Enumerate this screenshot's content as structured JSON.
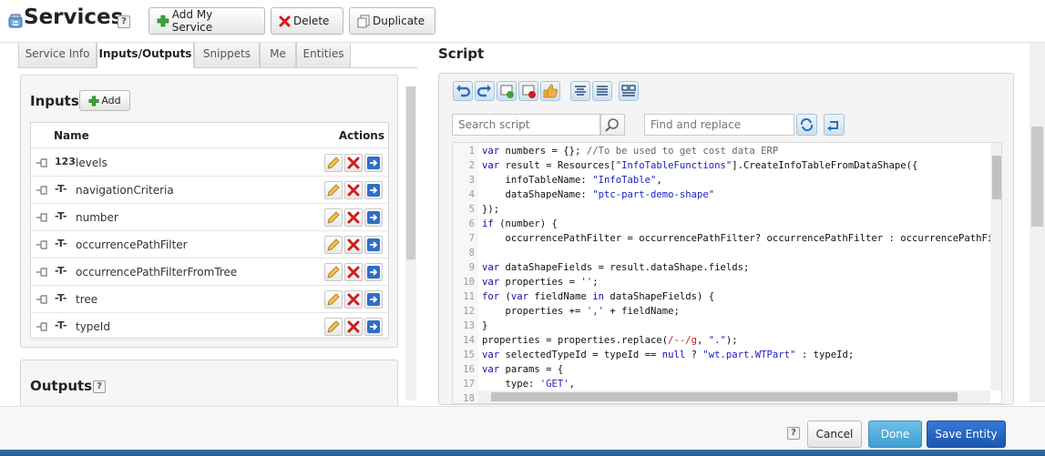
{
  "header": {
    "title": "Services",
    "help_label": "?",
    "add_service_label": "Add My Service",
    "delete_label": "Delete",
    "duplicate_label": "Duplicate"
  },
  "tabs": [
    "Service Info",
    "Inputs/Outputs",
    "Snippets",
    "Me",
    "Entities"
  ],
  "active_tab": "Inputs/Outputs",
  "inputs": {
    "heading": "Inputs",
    "add_label": "Add",
    "col_name": "Name",
    "col_actions": "Actions",
    "rows": [
      {
        "type_icon": "123",
        "name": "levels"
      },
      {
        "type_icon": "-T-",
        "name": "navigationCriteria"
      },
      {
        "type_icon": "-T-",
        "name": "number"
      },
      {
        "type_icon": "-T-",
        "name": "occurrencePathFilter"
      },
      {
        "type_icon": "-T-",
        "name": "occurrencePathFilterFromTree"
      },
      {
        "type_icon": "-T-",
        "name": "tree"
      },
      {
        "type_icon": "-T-",
        "name": "typeId"
      }
    ]
  },
  "outputs": {
    "heading": "Outputs",
    "help_label": "?"
  },
  "script": {
    "heading": "Script",
    "search_placeholder": "Search script",
    "find_placeholder": "Find and replace",
    "lines": [
      {
        "n": "1",
        "html": "<span class=\"kw\">var</span> numbers = {}; <span class=\"cm\">//To be used to get cost data ERP</span>"
      },
      {
        "n": "2",
        "html": "<span class=\"kw\">var</span> result = Resources[<span class=\"str\">\"InfoTableFunctions\"</span>].CreateInfoTableFromDataShape({"
      },
      {
        "n": "3",
        "html": "    infoTableName: <span class=\"str\">\"InfoTable\"</span>,"
      },
      {
        "n": "4",
        "html": "    dataShapeName: <span class=\"str\">\"ptc-part-demo-shape\"</span>"
      },
      {
        "n": "5",
        "html": "});"
      },
      {
        "n": "6",
        "html": "<span class=\"kw\">if</span> (number) {"
      },
      {
        "n": "7",
        "html": "    occurrencePathFilter = occurrencePathFilter? occurrencePathFilter : occurrencePathFilterFromT"
      },
      {
        "n": "8",
        "html": ""
      },
      {
        "n": "9",
        "html": "<span class=\"kw\">var</span> dataShapeFields = result.dataShape.fields;"
      },
      {
        "n": "10",
        "html": "<span class=\"kw\">var</span> properties = <span class=\"str\">''</span>;"
      },
      {
        "n": "11",
        "html": "<span class=\"kw\">for</span> (<span class=\"kw\">var</span> fieldName <span class=\"kw\">in</span> dataShapeFields) {"
      },
      {
        "n": "12",
        "html": "    properties += <span class=\"str\">','</span> + fieldName;"
      },
      {
        "n": "13",
        "html": "}"
      },
      {
        "n": "14",
        "html": "properties = properties.replace(<span class=\"re\">/--/g</span>, <span class=\"str\">\".\"</span>);"
      },
      {
        "n": "15",
        "html": "<span class=\"kw\">var</span> selectedTypeId = typeId == <span class=\"kw\">null</span> ? <span class=\"str\">\"wt.part.WTPart\"</span> : typeId;"
      },
      {
        "n": "16",
        "html": "<span class=\"kw\">var</span> params = {"
      },
      {
        "n": "17",
        "html": "    type: <span class=\"str\">'GET'</span>,"
      },
      {
        "n": "18",
        "html": ""
      }
    ]
  },
  "footer": {
    "help_label": "?",
    "cancel_label": "Cancel",
    "done_label": "Done",
    "save_label": "Save Entity"
  }
}
